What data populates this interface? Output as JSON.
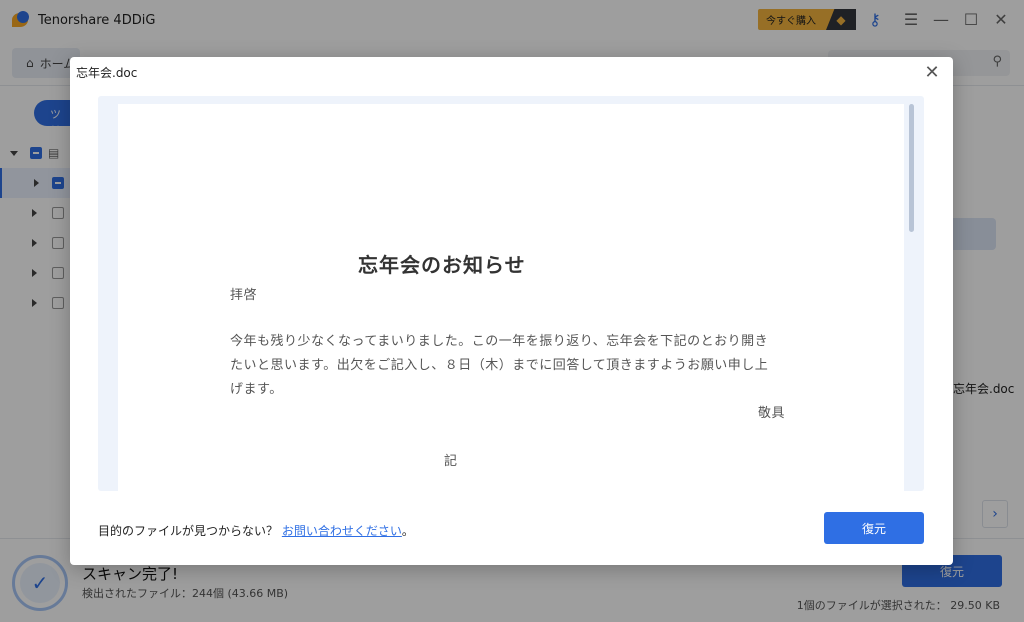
{
  "app": {
    "title": "Tenorshare 4DDiG",
    "buy_label": "今すぐ購入",
    "toolbar_icons": [
      "key-icon",
      "menu-icon",
      "minimize-icon",
      "maximize-icon",
      "close-icon"
    ]
  },
  "toolbar": {
    "home_label": "ホーム",
    "search_placeholder": ""
  },
  "sidebar": {
    "tree_tab_label": "ツリー"
  },
  "background": {
    "file_name_partial": "忘年会.doc",
    "scan_title": "スキャン完了!",
    "scan_detail": "検出されたファイル：244個 (43.66 MB)",
    "restore_label": "復元",
    "selection_info": "1個のファイルが選択された： 29.50 KB"
  },
  "dialog": {
    "title": "忘年会.doc",
    "footer_question": "目的のファイルが見つからない？",
    "footer_link": "お問い合わせください",
    "footer_end": "。",
    "restore_label": "復元"
  },
  "document": {
    "heading": "忘年会のお知らせ",
    "salutation": "拝啓",
    "body_line1": "今年も残り少なくなってまいりました。この一年を振り返り、忘年会を下記のとおり開き",
    "body_line2": "たいと思います。出欠をご記入し、８日（木）までに回答して頂きますようお願い申し上",
    "body_line3": "げます。",
    "closing": "敬具",
    "note": "記"
  },
  "colors": {
    "accent": "#2f6fe4",
    "buy_badge": "#f4b33e"
  }
}
